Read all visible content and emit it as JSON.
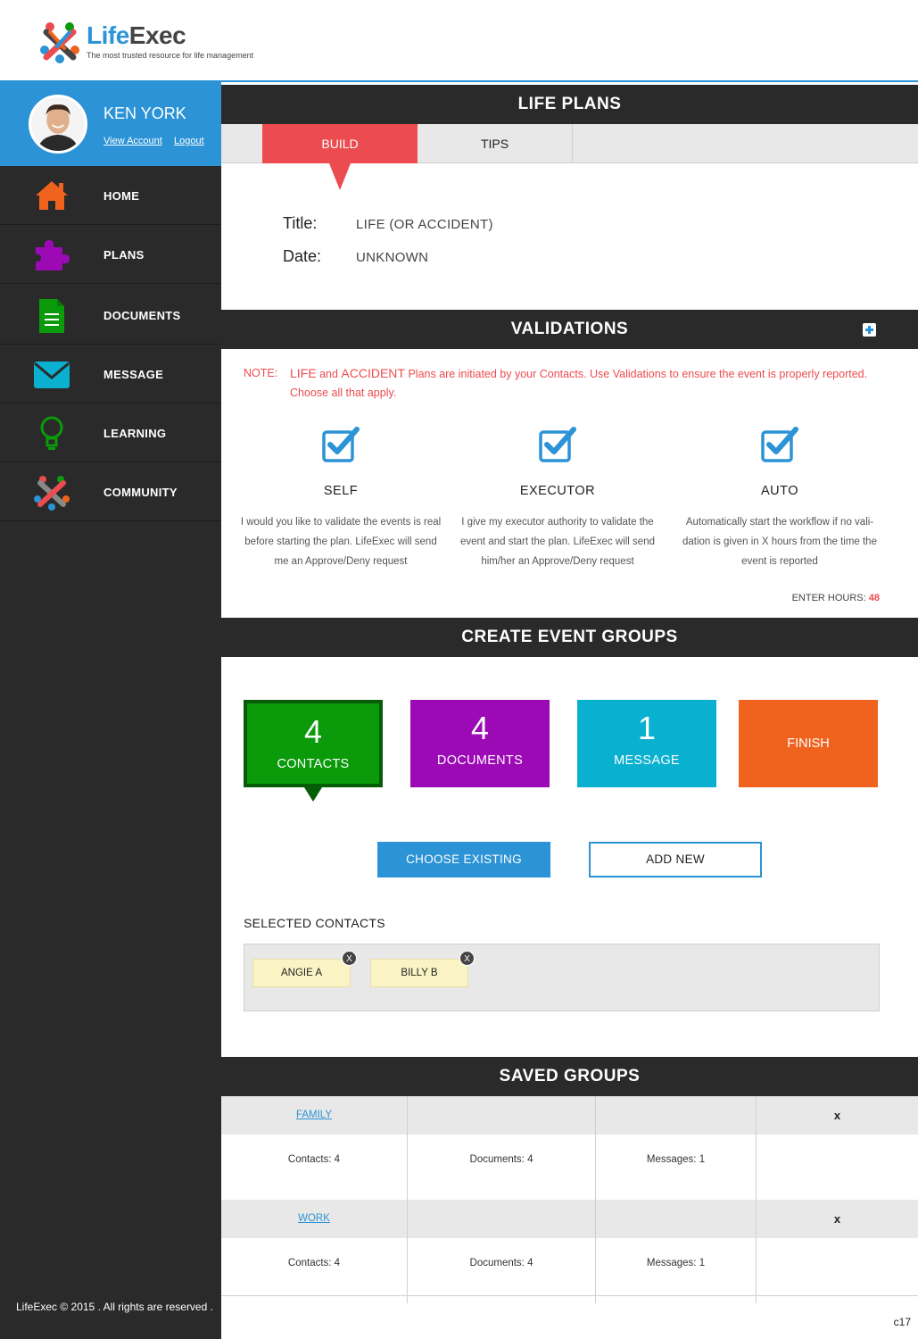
{
  "brand": {
    "name_part1": "Life",
    "name_part2": "Exec",
    "tagline": "The most trusted resource for life management"
  },
  "profile": {
    "name": "KEN YORK",
    "view_account": "View Account",
    "logout": "Logout"
  },
  "nav": [
    {
      "label": "HOME",
      "icon": "home-icon",
      "color": "#f0631e"
    },
    {
      "label": "PLANS",
      "icon": "puzzle-icon",
      "color": "#9b0ab5"
    },
    {
      "label": "DOCUMENTS",
      "icon": "document-icon",
      "color": "#0a9a0a"
    },
    {
      "label": "MESSAGE",
      "icon": "envelope-icon",
      "color": "#0ab0cf"
    },
    {
      "label": "LEARNING",
      "icon": "lightbulb-icon",
      "color": "#0a9a0a"
    },
    {
      "label": "COMMUNITY",
      "icon": "community-icon",
      "color": "#2b93d6"
    }
  ],
  "footer": {
    "copyright": "LifeExec © 2015 . All rights are reserved .",
    "page_code": "c17"
  },
  "life_plans": {
    "header": "LIFE PLANS",
    "tabs": [
      "BUILD",
      "TIPS"
    ],
    "active_tab": "BUILD",
    "title_label": "Title:",
    "title_value": "LIFE (OR ACCIDENT)",
    "date_label": "Date:",
    "date_value": "UNKNOWN"
  },
  "validations": {
    "header": "VALIDATIONS",
    "note_label": "NOTE:",
    "note_word_life": "LIFE",
    "note_word_and": "and",
    "note_word_accident": "ACCIDENT",
    "note_text": "Plans are initiated by your Contacts. Use Validations to ensure the event is properly reported. Choose all that apply.",
    "options": [
      {
        "title": "SELF",
        "checked": true,
        "description": "I would you like to validate the events is real before starting the plan. LifeExec will send me an Approve/Deny request"
      },
      {
        "title": "EXECUTOR",
        "checked": true,
        "description": "I give my executor authority to validate the event and start the plan. LifeExec will send him/her an Approve/Deny request"
      },
      {
        "title": "AUTO",
        "checked": true,
        "description": "Automatically start the workflow if no vali-dation is given in X hours from the time the event is reported"
      }
    ],
    "enter_hours_label": "ENTER HOURS:",
    "enter_hours_value": "48"
  },
  "event_groups": {
    "header": "CREATE EVENT GROUPS",
    "tiles": [
      {
        "count": "4",
        "label": "CONTACTS",
        "color": "#0a9a0a"
      },
      {
        "count": "4",
        "label": "DOCUMENTS",
        "color": "#9b0ab5"
      },
      {
        "count": "1",
        "label": "MESSAGE",
        "color": "#0ab0cf"
      },
      {
        "count": "",
        "label": "FINISH",
        "color": "#f0631e"
      }
    ],
    "choose_existing": "CHOOSE EXISTING",
    "add_new": "ADD NEW",
    "selected_label": "SELECTED CONTACTS",
    "selected_contacts": [
      "ANGIE A",
      "BILLY B"
    ],
    "remove_symbol": "X"
  },
  "saved_groups": {
    "header": "SAVED GROUPS",
    "groups": [
      {
        "name": "FAMILY",
        "contacts": "Contacts:  4",
        "documents": "Documents: 4",
        "messages": "Messages: 1",
        "remove": "x"
      },
      {
        "name": "WORK",
        "contacts": "Contacts:  4",
        "documents": "Documents: 4",
        "messages": "Messages: 1",
        "remove": "x"
      }
    ]
  },
  "colors": {
    "accent_blue": "#2b93d6",
    "alert_red": "#ec4b4f",
    "dark_bg": "#2a2a2a"
  }
}
